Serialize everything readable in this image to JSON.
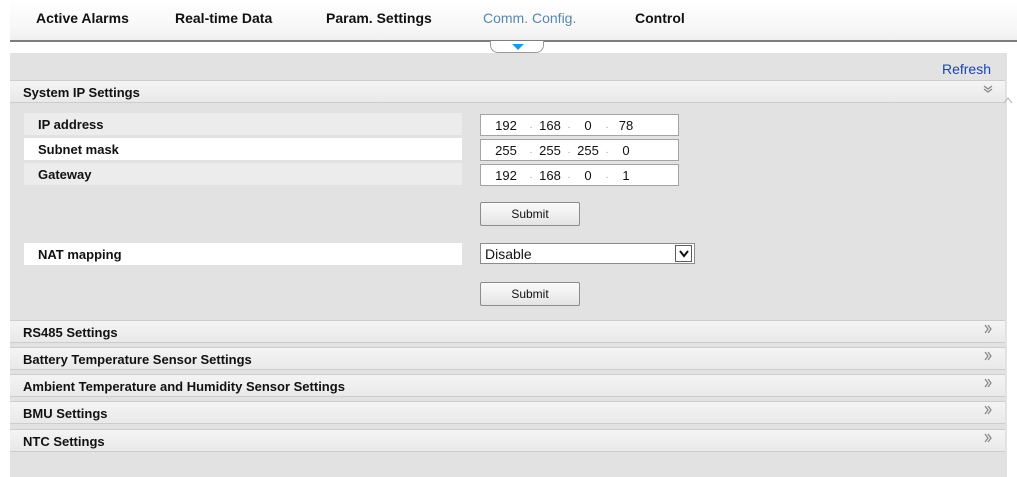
{
  "nav": {
    "tabs": [
      {
        "label": "Active Alarms"
      },
      {
        "label": "Real-time Data"
      },
      {
        "label": "Param. Settings"
      },
      {
        "label": "Comm. Config."
      },
      {
        "label": "Control"
      }
    ],
    "active_tab": "Comm. Config."
  },
  "toolbar": {
    "refresh_label": "Refresh"
  },
  "system_ip": {
    "title": "System IP Settings",
    "expanded_icon": "double-chevron-down-icon",
    "fields": [
      {
        "label": "IP address",
        "octets": [
          "192",
          "168",
          "0",
          "78"
        ]
      },
      {
        "label": "Subnet mask",
        "octets": [
          "255",
          "255",
          "255",
          "0"
        ]
      },
      {
        "label": "Gateway",
        "octets": [
          "192",
          "168",
          "0",
          "1"
        ]
      }
    ],
    "submit_label": "Submit",
    "nat": {
      "label": "NAT mapping",
      "value": "Disable"
    },
    "nat_submit_label": "Submit"
  },
  "sections": [
    {
      "title": "RS485 Settings"
    },
    {
      "title": "Battery Temperature Sensor Settings"
    },
    {
      "title": "Ambient Temperature and Humidity Sensor Settings"
    },
    {
      "title": "BMU Settings"
    },
    {
      "title": "NTC Settings"
    }
  ],
  "colors": {
    "active_tab": "#5a86ab",
    "refresh_link": "#1b43b4",
    "tab_indicator": "#1c9be0",
    "content_bg": "#e2e2e2"
  }
}
